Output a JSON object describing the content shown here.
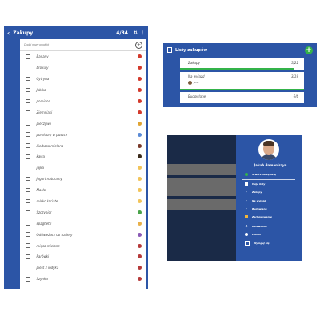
{
  "shopping": {
    "header": {
      "back": "‹",
      "title": "Zakupy",
      "count": "4/34"
    },
    "add_placeholder": "Dodaj nowy produkt",
    "items": [
      {
        "label": "Banany",
        "color": "#d33a2c"
      },
      {
        "label": "brokuły",
        "color": "#d33a2c"
      },
      {
        "label": "Cytryna",
        "color": "#d33a2c"
      },
      {
        "label": "Jabłka",
        "color": "#d33a2c"
      },
      {
        "label": "pomidor",
        "color": "#d33a2c"
      },
      {
        "label": "Ziemniaki",
        "color": "#d33a2c"
      },
      {
        "label": "pieczywo",
        "color": "#e0a434"
      },
      {
        "label": "pomidory w puszce",
        "color": "#5b8bd6"
      },
      {
        "label": "kiełbasa mielona",
        "color": "#7a3a2a"
      },
      {
        "label": "kawa",
        "color": "#3a2a1a"
      },
      {
        "label": "jajka",
        "color": "#f2c45a"
      },
      {
        "label": "Jogurt naturalny",
        "color": "#f2c45a"
      },
      {
        "label": "Masło",
        "color": "#f2c45a"
      },
      {
        "label": "mleko łaciate",
        "color": "#f2c45a"
      },
      {
        "label": "Szczypior",
        "color": "#4aa34a"
      },
      {
        "label": "spaghetti",
        "color": "#e8b04a"
      },
      {
        "label": "Odświeżacz do toalety",
        "color": "#8a5ab5"
      },
      {
        "label": "mięso mielone",
        "color": "#b53a3a"
      },
      {
        "label": "Parówki",
        "color": "#b53a3a"
      },
      {
        "label": "pierś z indyka",
        "color": "#b53a3a"
      },
      {
        "label": "Szynka",
        "color": "#b53a3a"
      }
    ]
  },
  "lists": {
    "title": "Listy zakupów",
    "plus": "+",
    "rows": [
      {
        "name": "Zakupy",
        "count": "5/22",
        "bar": "#34b34a"
      },
      {
        "name": "Na wyjazd",
        "count": "3/19",
        "bar": "#34b34a",
        "sub": "Jacek"
      },
      {
        "name": "Budowlane",
        "count": "6/6",
        "bar": "#34b34a"
      }
    ]
  },
  "drawer": {
    "name": "Jakub Romaniszyn",
    "new_list": "Stwórz nową listę",
    "my_lists": "Moje listy",
    "lists": [
      "Zakupy",
      "Na wyjazd",
      "Budowlane"
    ],
    "shopping_item": "Zachowywanie",
    "settings": "Ustawienia",
    "help": "Pomoc",
    "logout": "Wyloguj się"
  },
  "colors": {
    "primary": "#2c55a6",
    "accent": "#34b34a"
  }
}
